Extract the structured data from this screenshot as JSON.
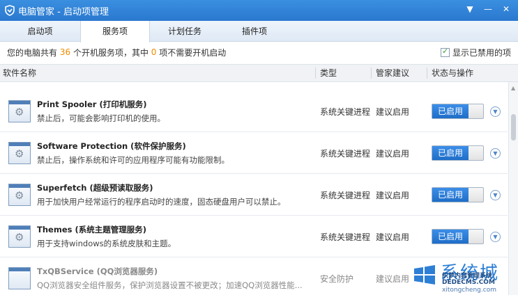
{
  "window": {
    "title": "电脑管家 - 启动项管理",
    "controls": [
      "▼",
      "—",
      "✕"
    ]
  },
  "tabs": [
    {
      "label": "启动项",
      "active": false
    },
    {
      "label": "服务项",
      "active": true
    },
    {
      "label": "计划任务",
      "active": false
    },
    {
      "label": "插件项",
      "active": false
    }
  ],
  "summary": {
    "prefix": "您的电脑共有",
    "count": "36",
    "mid": "个开机服务项，其中",
    "unneeded": "0",
    "suffix": "项不需要开机启动"
  },
  "show_disabled": {
    "label": "显示已禁用的项",
    "checked": true
  },
  "columns": {
    "name": "软件名称",
    "type": "类型",
    "advice": "管家建议",
    "status": "状态与操作"
  },
  "rows": [
    {
      "title": "Print Spooler (打印机服务)",
      "desc": "禁止后，可能会影响打印机的使用。",
      "type": "系统关键进程",
      "advice": "建议启用",
      "status": "已启用",
      "icon": "gear-icon"
    },
    {
      "title": "Software Protection (软件保护服务)",
      "desc": "禁止后，操作系统和许可的应用程序可能有功能限制。",
      "type": "系统关键进程",
      "advice": "建议启用",
      "status": "已启用",
      "icon": "gear-icon"
    },
    {
      "title": "Superfetch (超级预读取服务)",
      "desc": "用于加快用户经常运行的程序启动时的速度，固态硬盘用户可以禁止。",
      "type": "系统关键进程",
      "advice": "建议启用",
      "status": "已启用",
      "icon": "gear-icon"
    },
    {
      "title": "Themes (系统主题管理服务)",
      "desc": "用于支持windows的系统皮肤和主题。",
      "type": "系统关键进程",
      "advice": "建议启用",
      "status": "已启用",
      "icon": "gear-icon"
    },
    {
      "title": "TxQBService (QQ浏览器服务)",
      "desc": "QQ浏览器安全组件服务，保护浏览器设置不被更改；加速QQ浏览器性能...",
      "type": "安全防护",
      "advice": "建议启用",
      "status": "",
      "icon": "window-icon"
    }
  ],
  "watermark": {
    "big": "系统城",
    "line1": "织梦内容管理系统",
    "line2": "DEDECMS.COM",
    "line3": "xitongcheng.com"
  },
  "colors": {
    "titlebar": "#2a78cf",
    "toggle_on": "#1f6ec8",
    "highlight_number": "#f08a00"
  }
}
